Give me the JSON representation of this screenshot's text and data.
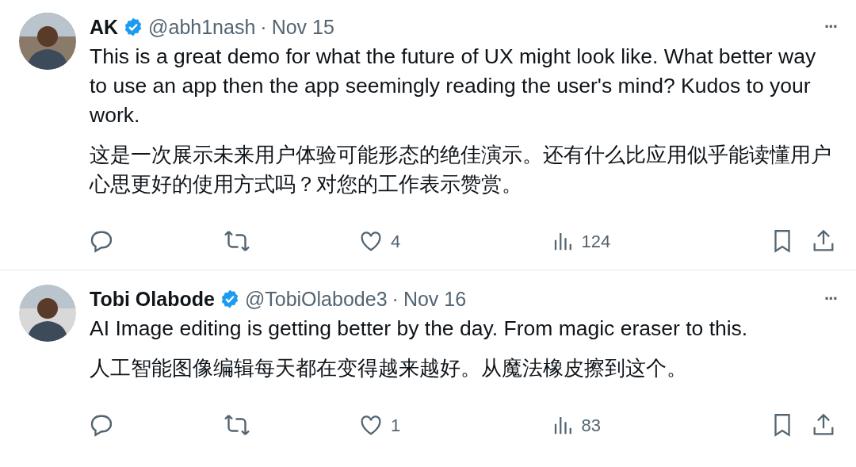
{
  "tweets": [
    {
      "name": "AK",
      "verified": true,
      "handle": "@abh1nash",
      "separator": "·",
      "date": "Nov 15",
      "more": "···",
      "paragraphs": [
        "This is a great demo for what the future of UX might look like. What better way to use an app then the app seemingly reading the user's mind? Kudos to your work.",
        "这是一次展示未来用户体验可能形态的绝佳演示。还有什么比应用似乎能读懂用户心思更好的使用方式吗？对您的工作表示赞赏。"
      ],
      "likes": "4",
      "views": "124"
    },
    {
      "name": "Tobi Olabode",
      "verified": true,
      "handle": "@TobiOlabode3",
      "separator": "·",
      "date": "Nov 16",
      "more": "···",
      "paragraphs": [
        "AI Image editing is getting better by the day. From magic eraser to this.",
        "人工智能图像编辑每天都在变得越来越好。从魔法橡皮擦到这个。"
      ],
      "likes": "1",
      "views": "83"
    }
  ]
}
